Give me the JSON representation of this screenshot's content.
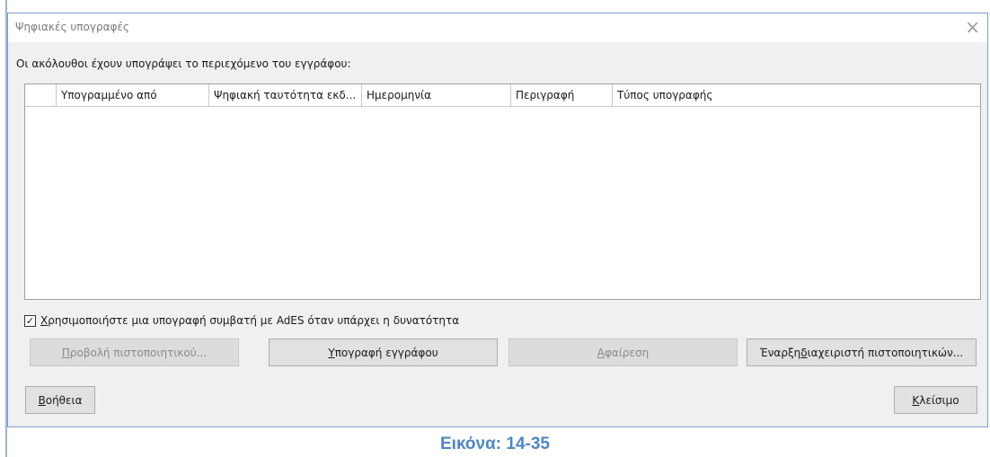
{
  "window": {
    "title": "Ψηφιακές υπογραφές",
    "close_glyph": "×"
  },
  "intro_text": "Οι ακόλουθοι έχουν υπογράψει το περιεχόμενο του εγγράφου:",
  "table": {
    "columns": [
      "",
      "Υπογραμμένο από",
      "Ψηφιακή ταυτότητα εκδ...",
      "Ημερομηνία",
      "Περιγραφή",
      "Τύπος υπογραφής"
    ],
    "rows": []
  },
  "ades_checkbox": {
    "label_mnemonic": "Χ",
    "label_rest": "ρησιμοποιήστε μια υπογραφή συμβατή με AdES όταν υπάρχει η δυνατότητα",
    "checked": true,
    "check_glyph": "✓"
  },
  "buttons": {
    "view_certificate": {
      "mnemonic": "Π",
      "rest": "ροβολή πιστοποιητικού...",
      "enabled": false
    },
    "sign_document": {
      "mnemonic": "Υ",
      "rest": "πογραφή εγγράφου",
      "enabled": true
    },
    "remove": {
      "mnemonic": "Α",
      "rest": "φαίρεση",
      "enabled": false
    },
    "cert_manager": {
      "prefix": "Έναρξη ",
      "mnemonic": "δ",
      "rest": "ιαχειριστή πιστοποιητικών...",
      "enabled": true
    },
    "help": {
      "mnemonic": "Β",
      "rest": "οήθεια",
      "enabled": true
    },
    "close": {
      "mnemonic": "Κ",
      "rest": "λείσιμο",
      "enabled": true
    }
  },
  "caption": "Εικόνα: 14-35",
  "colors": {
    "accent": "#4f86c6",
    "dialog_bg": "#f0f0f0",
    "border": "#7a9fd4"
  }
}
